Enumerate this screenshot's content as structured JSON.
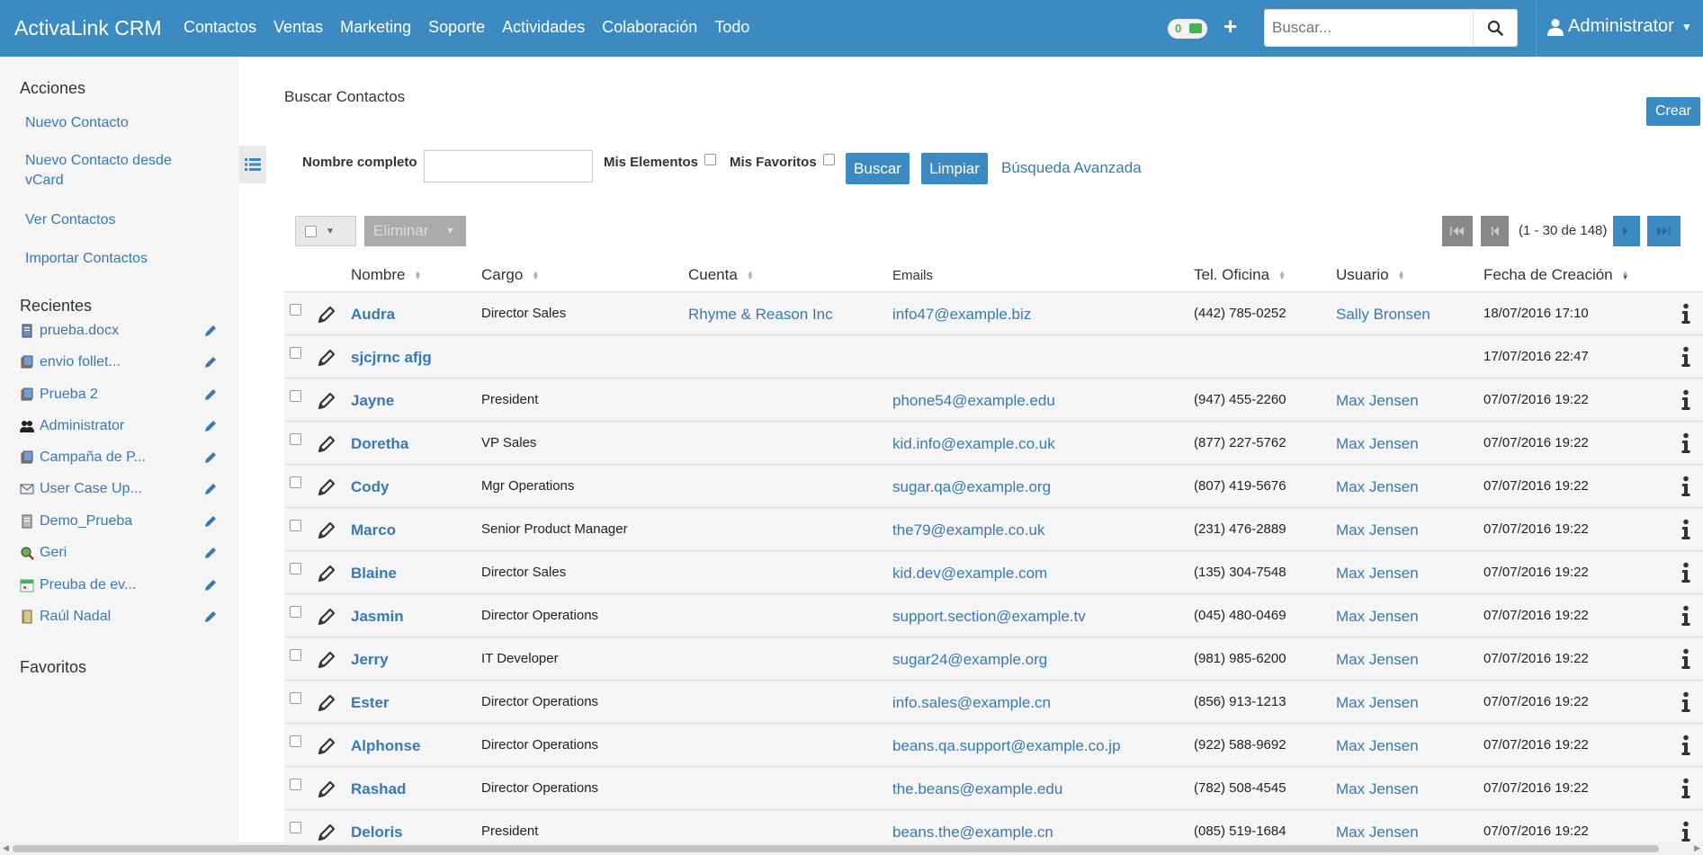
{
  "header": {
    "brand": "ActivaLink CRM",
    "nav": [
      "Contactos",
      "Ventas",
      "Marketing",
      "Soporte",
      "Actividades",
      "Colaboración",
      "Todo"
    ],
    "notification_count": "0",
    "search_placeholder": "Buscar...",
    "user": "Administrator"
  },
  "sidebar": {
    "actions_title": "Acciones",
    "actions": [
      "Nuevo Contacto",
      "Nuevo Contacto desde vCard",
      "Ver Contactos",
      "Importar Contactos"
    ],
    "recent_title": "Recientes",
    "recent": [
      {
        "label": "prueba.docx",
        "icon": "document-icon"
      },
      {
        "label": "envio follet...",
        "icon": "campaign-icon"
      },
      {
        "label": "Prueba 2",
        "icon": "campaign-icon"
      },
      {
        "label": "Administrator",
        "icon": "users-icon"
      },
      {
        "label": "Campaña de P...",
        "icon": "campaign-icon"
      },
      {
        "label": "User Case Up...",
        "icon": "email-icon"
      },
      {
        "label": "Demo_Prueba",
        "icon": "document-icon"
      },
      {
        "label": "Geri",
        "icon": "lead-icon"
      },
      {
        "label": "Preuba de ev...",
        "icon": "calendar-icon"
      },
      {
        "label": "Raúl Nadal",
        "icon": "contact-icon"
      }
    ],
    "favorites_title": "Favoritos"
  },
  "main": {
    "title": "Buscar Contactos",
    "create_label": "Crear",
    "filter": {
      "name_label": "Nombre completo",
      "name_value": "",
      "my_items_label": "Mis Elementos",
      "favorites_label": "Mis Favoritos",
      "search_label": "Buscar",
      "clear_label": "Limpiar",
      "advanced_label": "Búsqueda Avanzada"
    },
    "toolbar": {
      "delete_label": "Eliminar",
      "pagination_text": "(1 - 30 de 148)"
    },
    "columns": [
      "Nombre",
      "Cargo",
      "Cuenta",
      "Emails",
      "Tel. Oficina",
      "Usuario",
      "Fecha de Creación"
    ],
    "rows": [
      {
        "name": "Audra",
        "cargo": "Director Sales",
        "cuenta": "Rhyme & Reason Inc",
        "email": "info47@example.biz",
        "tel": "(442) 785-0252",
        "user": "Sally Bronsen",
        "date": "18/07/2016 17:10"
      },
      {
        "name": "sjcjrnc afjg",
        "cargo": "",
        "cuenta": "",
        "email": "",
        "tel": "",
        "user": "",
        "date": "17/07/2016 22:47"
      },
      {
        "name": "Jayne",
        "cargo": "President",
        "cuenta": "",
        "email": "phone54@example.edu",
        "tel": "(947) 455-2260",
        "user": "Max Jensen",
        "date": "07/07/2016 19:22"
      },
      {
        "name": "Doretha",
        "cargo": "VP Sales",
        "cuenta": "",
        "email": "kid.info@example.co.uk",
        "tel": "(877) 227-5762",
        "user": "Max Jensen",
        "date": "07/07/2016 19:22"
      },
      {
        "name": "Cody",
        "cargo": "Mgr Operations",
        "cuenta": "",
        "email": "sugar.qa@example.org",
        "tel": "(807) 419-5676",
        "user": "Max Jensen",
        "date": "07/07/2016 19:22"
      },
      {
        "name": "Marco",
        "cargo": "Senior Product Manager",
        "cuenta": "",
        "email": "the79@example.co.uk",
        "tel": "(231) 476-2889",
        "user": "Max Jensen",
        "date": "07/07/2016 19:22"
      },
      {
        "name": "Blaine",
        "cargo": "Director Sales",
        "cuenta": "",
        "email": "kid.dev@example.com",
        "tel": "(135) 304-7548",
        "user": "Max Jensen",
        "date": "07/07/2016 19:22"
      },
      {
        "name": "Jasmin",
        "cargo": "Director Operations",
        "cuenta": "",
        "email": "support.section@example.tv",
        "tel": "(045) 480-0469",
        "user": "Max Jensen",
        "date": "07/07/2016 19:22"
      },
      {
        "name": "Jerry",
        "cargo": "IT Developer",
        "cuenta": "",
        "email": "sugar24@example.org",
        "tel": "(981) 985-6200",
        "user": "Max Jensen",
        "date": "07/07/2016 19:22"
      },
      {
        "name": "Ester",
        "cargo": "Director Operations",
        "cuenta": "",
        "email": "info.sales@example.cn",
        "tel": "(856) 913-1213",
        "user": "Max Jensen",
        "date": "07/07/2016 19:22"
      },
      {
        "name": "Alphonse",
        "cargo": "Director Operations",
        "cuenta": "",
        "email": "beans.qa.support@example.co.jp",
        "tel": "(922) 588-9692",
        "user": "Max Jensen",
        "date": "07/07/2016 19:22"
      },
      {
        "name": "Rashad",
        "cargo": "Director Operations",
        "cuenta": "",
        "email": "the.beans@example.edu",
        "tel": "(782) 508-4545",
        "user": "Max Jensen",
        "date": "07/07/2016 19:22"
      },
      {
        "name": "Deloris",
        "cargo": "President",
        "cuenta": "",
        "email": "beans.the@example.cn",
        "tel": "(085) 519-1684",
        "user": "Max Jensen",
        "date": "07/07/2016 19:22"
      }
    ]
  },
  "colors": {
    "primary": "#3b8bc2",
    "link": "#3a78b5",
    "sidebar_bg": "#f5f5f5"
  }
}
